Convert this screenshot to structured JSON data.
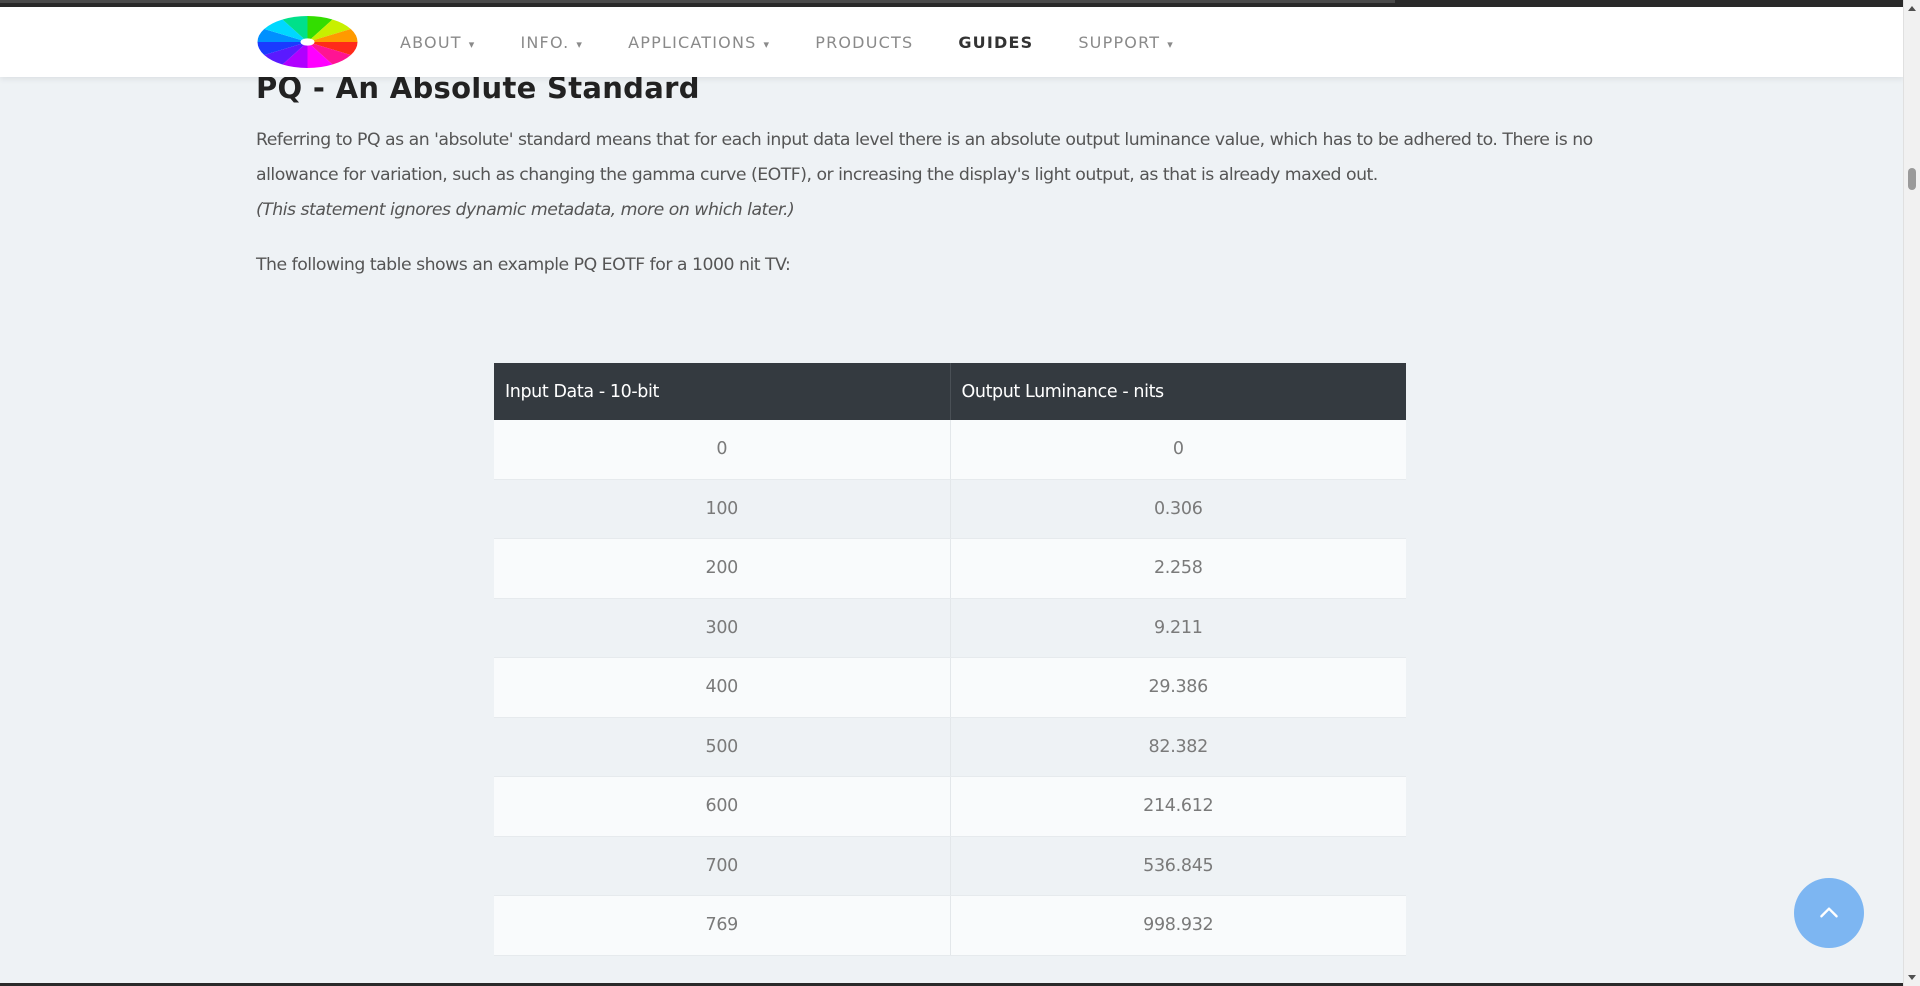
{
  "nav": {
    "logo_icon": "color-wheel-logo",
    "items": [
      {
        "label": "ABOUT",
        "dropdown": true,
        "active": false
      },
      {
        "label": "INFO.",
        "dropdown": true,
        "active": false
      },
      {
        "label": "APPLICATIONS",
        "dropdown": true,
        "active": false
      },
      {
        "label": "PRODUCTS",
        "dropdown": false,
        "active": false
      },
      {
        "label": "GUIDES",
        "dropdown": false,
        "active": true
      },
      {
        "label": "SUPPORT",
        "dropdown": true,
        "active": false
      }
    ],
    "caret_glyph": "▾"
  },
  "article": {
    "title": "PQ - An Absolute Standard",
    "paragraph": "Referring to PQ as an 'absolute' standard means that for each input data level there is an absolute output luminance value, which has to be adhered to. There is no allowance for variation, such as changing the gamma curve (EOTF), or increasing the display's light output, as that is already maxed out.",
    "note": "(This statement ignores dynamic metadata, more on which later.)",
    "lead": "The following table shows an example PQ EOTF for a 1000 nit TV:"
  },
  "table": {
    "headers": [
      "Input Data - 10-bit",
      "Output Luminance - nits"
    ],
    "rows": [
      [
        "0",
        "0"
      ],
      [
        "100",
        "0.306"
      ],
      [
        "200",
        "2.258"
      ],
      [
        "300",
        "9.211"
      ],
      [
        "400",
        "29.386"
      ],
      [
        "500",
        "82.382"
      ],
      [
        "600",
        "214.612"
      ],
      [
        "700",
        "536.845"
      ],
      [
        "769",
        "998.932"
      ]
    ]
  },
  "back_to_top": {
    "icon": "chevron-up-icon"
  },
  "colors": {
    "page_bg": "#eef2f5",
    "table_header_bg": "#343a40",
    "back_to_top_bg": "#7db6f2",
    "nav_active": "#333333",
    "nav_inactive": "#8a8a8a"
  }
}
